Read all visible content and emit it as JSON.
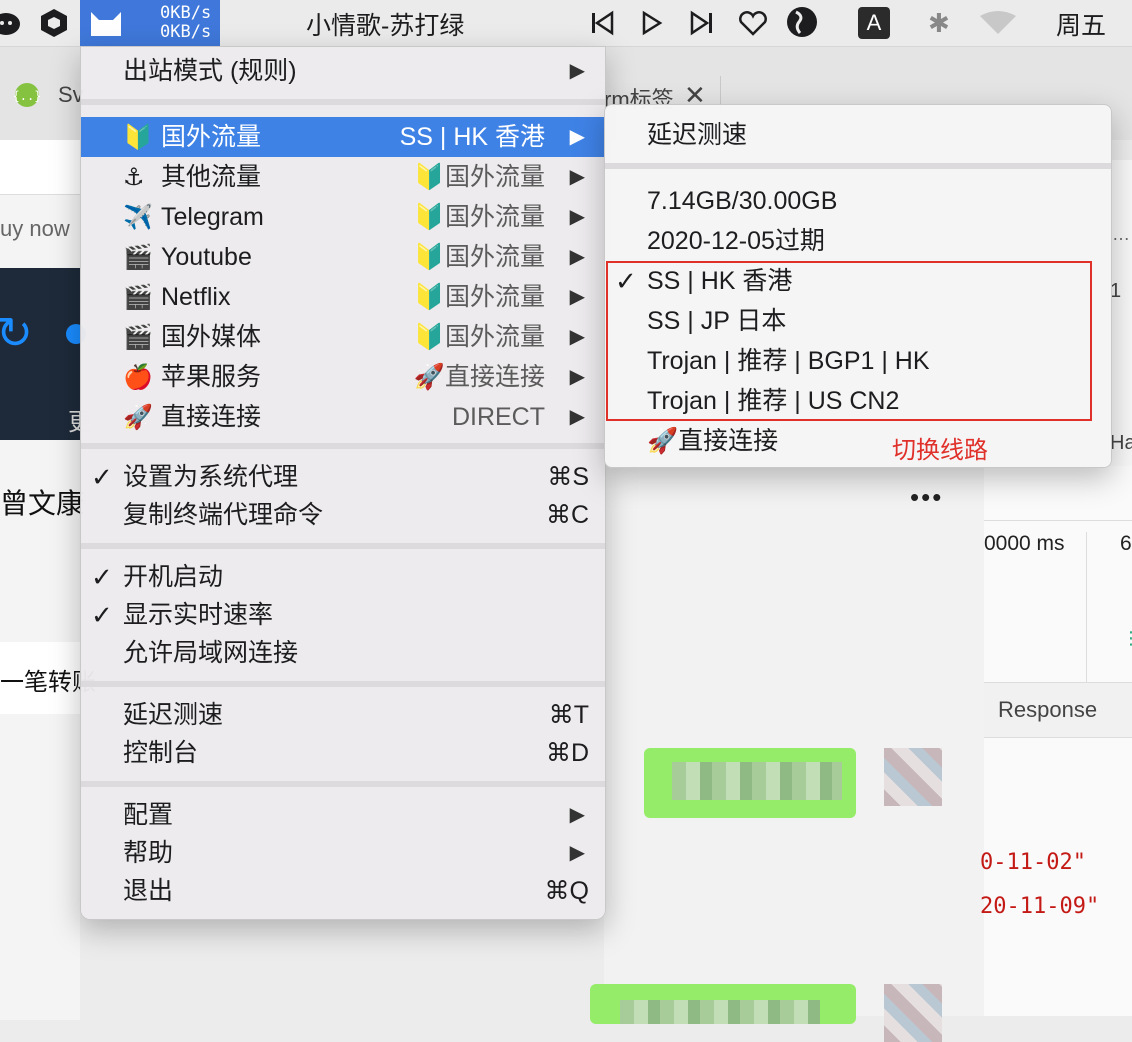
{
  "menubar": {
    "speed_up": "0KB/s",
    "speed_down": "0KB/s",
    "track": "小情歌-苏打绿",
    "clock": "周五",
    "input_letter": "A"
  },
  "background": {
    "tab_left": "Sv",
    "tab_mid": "rm标签",
    "buy_now": "uy now",
    "name": "曾文康",
    "transfer": "一笔转账",
    "time_ms": "0000 ms",
    "time_ms2": "6",
    "ha": "Ha",
    "response": "Response",
    "date1": "0-11-02\"",
    "date2": "20-11-09\"",
    "char_geng": "更",
    "char_one": "1"
  },
  "menu": {
    "outbound": "出站模式 (规则)",
    "proxies": [
      {
        "label": "国外流量",
        "emoji": "🔰",
        "value": "SS | HK 香港"
      },
      {
        "label": "其他流量",
        "emoji": "⚓",
        "value": "🔰国外流量"
      },
      {
        "label": "Telegram",
        "emoji": "✈️",
        "value": "🔰国外流量"
      },
      {
        "label": "Youtube",
        "emoji": "🎬",
        "value": "🔰国外流量"
      },
      {
        "label": "Netflix",
        "emoji": "🎬",
        "value": "🔰国外流量"
      },
      {
        "label": "国外媒体",
        "emoji": "🎬",
        "value": "🔰国外流量"
      },
      {
        "label": "苹果服务",
        "emoji": "🍎",
        "value": "🚀直接连接"
      },
      {
        "label": "直接连接",
        "emoji": "🚀",
        "value": "DIRECT"
      }
    ],
    "system_proxy": "设置为系统代理",
    "system_proxy_sc": "⌘S",
    "copy_cmd": "复制终端代理命令",
    "copy_cmd_sc": "⌘C",
    "launch_at_login": "开机启动",
    "show_speed": "显示实时速率",
    "allow_lan": "允许局域网连接",
    "latency_test": "延迟测速",
    "latency_test_sc": "⌘T",
    "dashboard": "控制台",
    "dashboard_sc": "⌘D",
    "config": "配置",
    "help": "帮助",
    "quit": "退出",
    "quit_sc": "⌘Q",
    "arrow": "▶",
    "check": "✓"
  },
  "submenu": {
    "latency_test": "延迟测速",
    "usage": "7.14GB/30.00GB",
    "expiry": "2020-12-05过期",
    "nodes": [
      "SS | HK 香港",
      "SS | JP 日本",
      "Trojan | 推荐 | BGP1 | HK",
      "Trojan | 推荐 | US CN2"
    ],
    "direct": "🚀直接连接",
    "annotation": "切换线路"
  }
}
